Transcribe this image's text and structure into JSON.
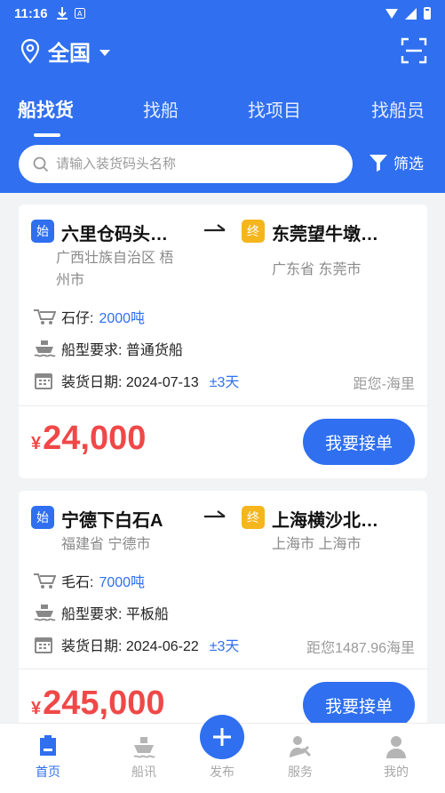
{
  "status_bar": {
    "time": "11:16"
  },
  "header": {
    "location": "全国",
    "tabs": [
      {
        "label": "船找货",
        "active": true
      },
      {
        "label": "找船",
        "active": false
      },
      {
        "label": "找项目",
        "active": false
      },
      {
        "label": "找船员",
        "active": false
      }
    ],
    "search_placeholder": "请输入装货码头名称",
    "filter_label": "筛选"
  },
  "orders": [
    {
      "start_badge": "始",
      "start_port": "六里仓码头…",
      "start_region_line1": "广西壮族自治区 梧",
      "start_region_line2": "州市",
      "end_badge": "终",
      "end_port": "东莞望牛墩…",
      "end_region": "广东省 东莞市",
      "cargo_label": "石仔:",
      "cargo_amount": "2000吨",
      "ship_type": "船型要求:  普通货船",
      "load_date": "装货日期:  2024-07-13",
      "date_range": "±3天",
      "distance": "距您-海里",
      "currency": "¥",
      "price": "24,000",
      "accept_label": "我要接单"
    },
    {
      "start_badge": "始",
      "start_port": "宁德下白石A",
      "start_region_line1": "福建省 宁德市",
      "start_region_line2": "",
      "end_badge": "终",
      "end_port": "上海横沙北…",
      "end_region": "上海市 上海市",
      "cargo_label": "毛石:",
      "cargo_amount": "7000吨",
      "ship_type": "船型要求:  平板船",
      "load_date": "装货日期:  2024-06-22",
      "date_range": "±3天",
      "distance": "距您1487.96海里",
      "currency": "¥",
      "price": "245,000",
      "accept_label": "我要接单"
    }
  ],
  "bottom_nav": [
    {
      "label": "首页",
      "icon": "home-icon",
      "active": true
    },
    {
      "label": "船讯",
      "icon": "ship-icon",
      "active": false
    },
    {
      "label": "发布",
      "icon": "plus-icon",
      "active": false
    },
    {
      "label": "服务",
      "icon": "service-icon",
      "active": false
    },
    {
      "label": "我的",
      "icon": "profile-icon",
      "active": false
    }
  ],
  "colors": {
    "primary": "#2f6ff0",
    "price": "#f04848",
    "end_badge": "#f5b51c"
  }
}
